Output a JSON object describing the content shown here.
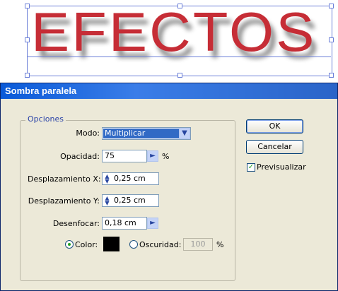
{
  "artwork": {
    "text": "EFECTOS",
    "color": "#c62d36"
  },
  "dialog": {
    "title": "Sombra paralela",
    "group_label": "Opciones",
    "mode": {
      "label": "Modo:",
      "value": "Multiplicar"
    },
    "opacity": {
      "label": "Opacidad:",
      "value": "75",
      "unit": "%"
    },
    "offset_x": {
      "label": "Desplazamiento X:",
      "value": "0,25 cm"
    },
    "offset_y": {
      "label": "Desplazamiento Y:",
      "value": "0,25 cm"
    },
    "blur": {
      "label": "Desenfocar:",
      "value": "0,18 cm"
    },
    "color_option": {
      "label": "Color:",
      "selected": true,
      "swatch": "#000000"
    },
    "darkness_option": {
      "label": "Oscuridad:",
      "value": "100",
      "unit": "%"
    },
    "buttons": {
      "ok": "OK",
      "cancel": "Cancelar"
    },
    "preview": {
      "label": "Previsualizar",
      "checked": true
    }
  }
}
